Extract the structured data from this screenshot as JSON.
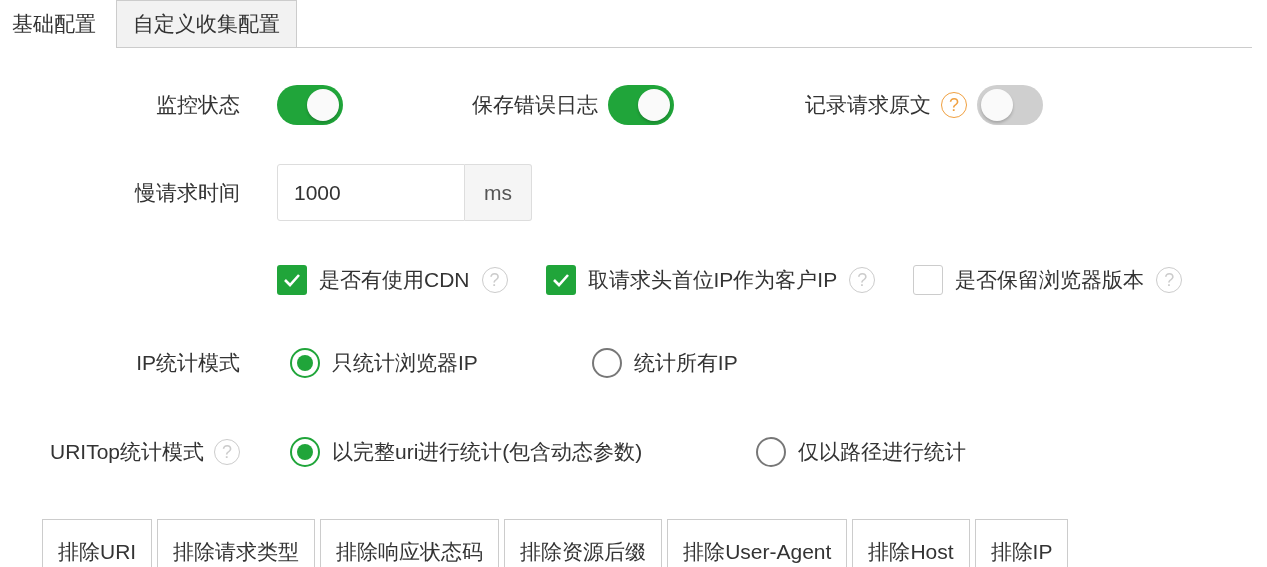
{
  "tabs": [
    {
      "label": "基础配置",
      "selected": true
    },
    {
      "label": "自定义收集配置",
      "selected": false
    }
  ],
  "switches": [
    {
      "label": "监控状态",
      "on": true
    },
    {
      "label": "保存错误日志",
      "on": true
    },
    {
      "label": "记录请求原文",
      "on": false,
      "help": "?"
    }
  ],
  "slow_request": {
    "label": "慢请求时间",
    "value": "1000",
    "unit": "ms"
  },
  "checkboxes": [
    {
      "label": "是否有使用CDN",
      "checked": true,
      "help": "?"
    },
    {
      "label": "取请求头首位IP作为客户IP",
      "checked": true,
      "help": "?"
    },
    {
      "label": "是否保留浏览器版本",
      "checked": false,
      "help": "?"
    }
  ],
  "ip_mode": {
    "label": "IP统计模式",
    "options": [
      {
        "label": "只统计浏览器IP",
        "selected": true
      },
      {
        "label": "统计所有IP",
        "selected": false
      }
    ]
  },
  "uri_mode": {
    "label": "URITop统计模式",
    "help": "?",
    "options": [
      {
        "label": "以完整uri进行统计(包含动态参数)",
        "selected": true
      },
      {
        "label": "仅以路径进行统计",
        "selected": false
      }
    ]
  },
  "exclude_tabs": [
    "排除URI",
    "排除请求类型",
    "排除响应状态码",
    "排除资源后缀",
    "排除User-Agent",
    "排除Host",
    "排除IP"
  ]
}
